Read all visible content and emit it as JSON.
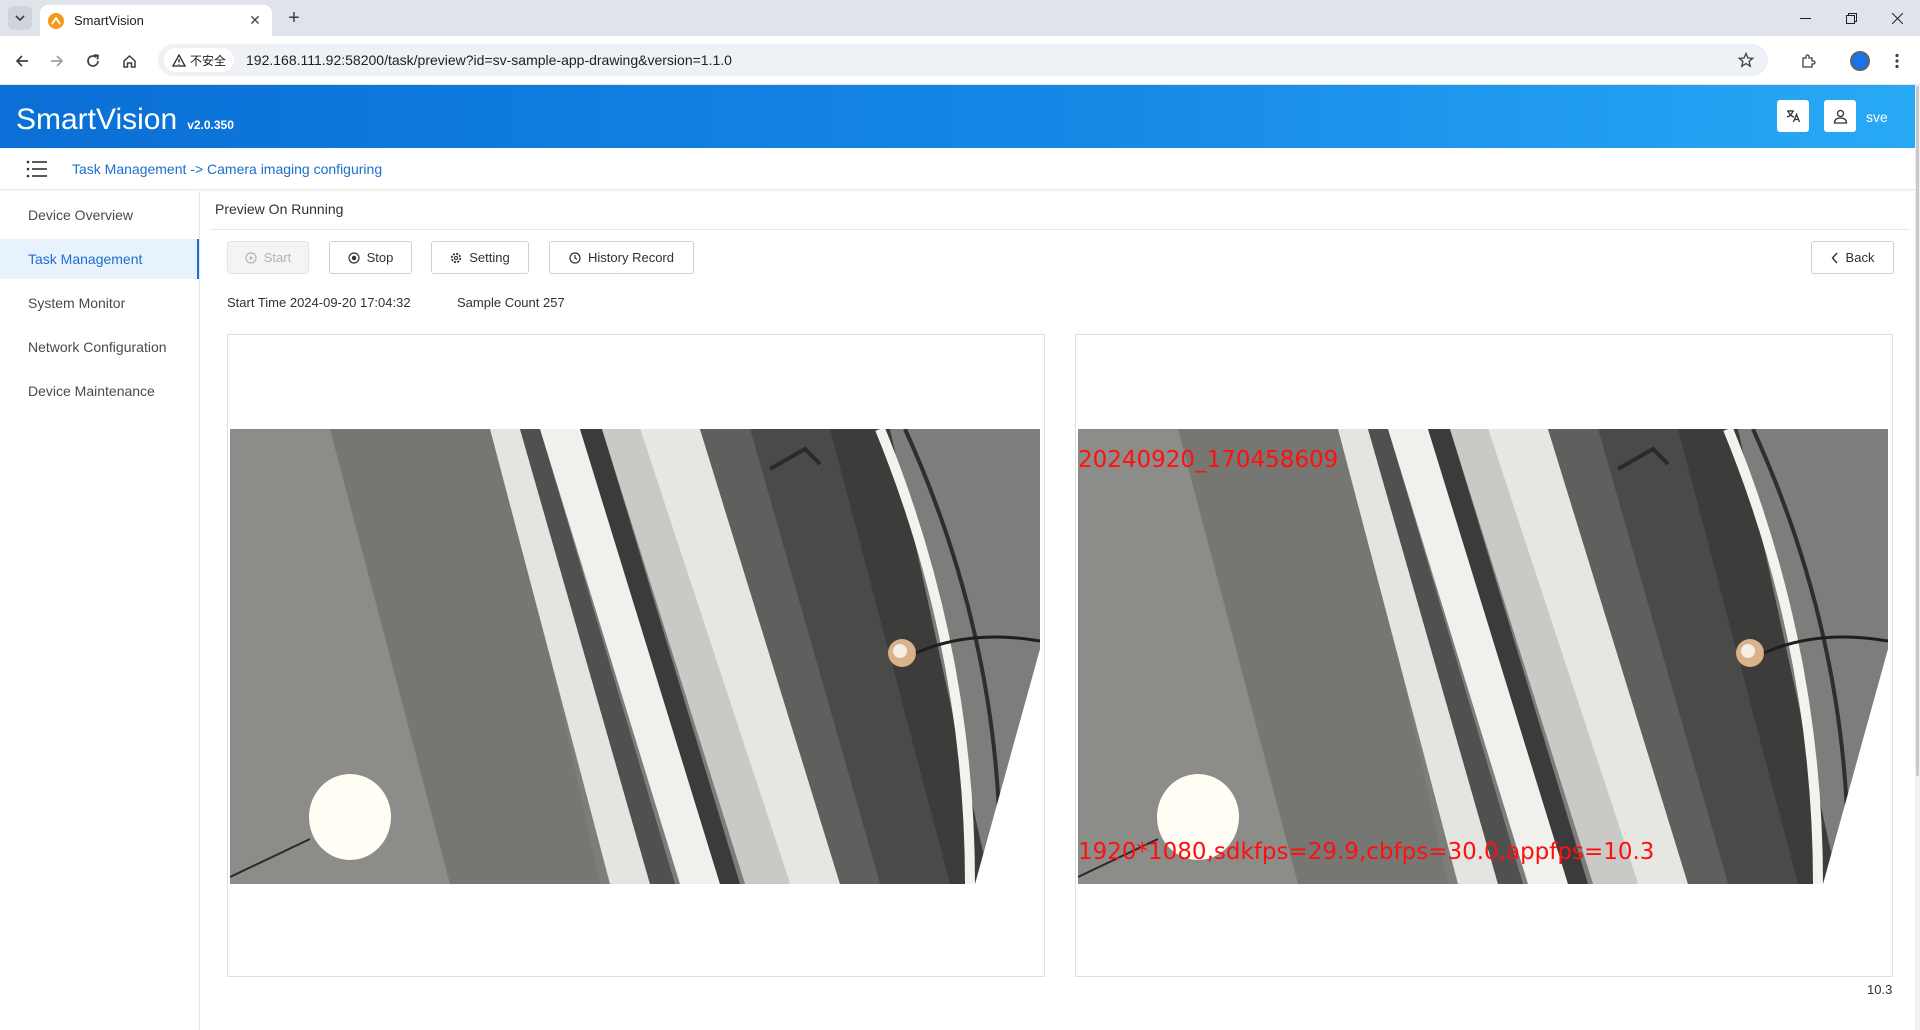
{
  "browser": {
    "tab_title": "SmartVision",
    "security_label": "不安全",
    "url": "192.168.111.92:58200/task/preview?id=sv-sample-app-drawing&version=1.1.0"
  },
  "header": {
    "brand": "SmartVision",
    "version": "v2.0.350",
    "user": "sve"
  },
  "breadcrumb": "Task Management -> Camera imaging configuring",
  "sidebar": {
    "items": [
      {
        "label": "Device Overview"
      },
      {
        "label": "Task Management"
      },
      {
        "label": "System Monitor"
      },
      {
        "label": "Network Configuration"
      },
      {
        "label": "Device Maintenance"
      }
    ]
  },
  "main": {
    "title": "Preview On Running",
    "buttons": {
      "start": "Start",
      "stop": "Stop",
      "setting": "Setting",
      "history": "History Record",
      "back": "Back"
    },
    "start_time": "Start Time 2024-09-20 17:04:32",
    "sample_count": "Sample Count 257",
    "overlay_top": "20240920_170458609",
    "overlay_bottom": "1920*1080,sdkfps=29.9,cbfps=30.0,appfps=10.3",
    "fps_readout": "10.3"
  },
  "colors": {
    "accent": "#1a6fd0",
    "overlay_text": "#ff1010"
  }
}
